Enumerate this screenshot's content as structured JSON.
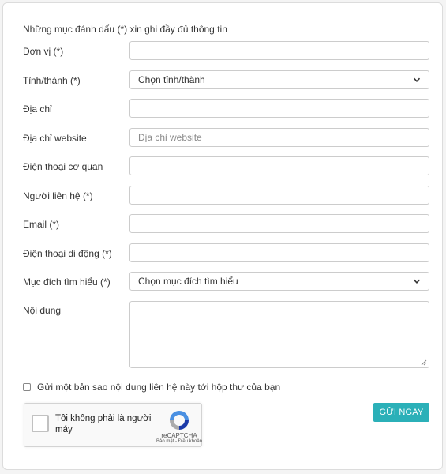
{
  "form": {
    "note": "Những mục đánh dấu (*) xin ghi đầy đủ thông tin",
    "labels": {
      "don_vi": "Đơn vị (*)",
      "tinh_thanh": "Tỉnh/thành (*)",
      "dia_chi": "Địa chỉ",
      "website": "Địa chỉ website",
      "dien_thoai_co_quan": "Điện thoại cơ quan",
      "nguoi_lien_he": "Người liên hệ (*)",
      "email": "Email (*)",
      "di_dong": "Điện thoại di động (*)",
      "muc_dich": "Mục đích tìm hiểu (*)",
      "noi_dung": "Nội dung"
    },
    "values": {
      "don_vi": "",
      "dia_chi": "",
      "website": "",
      "dien_thoai_co_quan": "",
      "nguoi_lien_he": "",
      "email": "",
      "di_dong": "",
      "noi_dung": ""
    },
    "placeholders": {
      "website": "Địa chỉ website"
    },
    "selects": {
      "tinh_thanh": "Chọn tỉnh/thành",
      "muc_dich": "Chọn mục đích tìm hiểu"
    },
    "copy_checkbox_label": "Gửi một bản sao nội dung liên hệ này tới hộp thư của bạn",
    "submit_label": "GỬI NGAY"
  },
  "captcha": {
    "text": "Tôi không phải là người máy",
    "brand": "reCAPTCHA",
    "links": "Bảo mật - Điều khoản"
  },
  "colors": {
    "accent": "#2bb0b8",
    "border": "#cccccc"
  },
  "icons": {
    "select_arrow": "chevron-down-icon",
    "recaptcha": "recaptcha-logo-icon"
  }
}
